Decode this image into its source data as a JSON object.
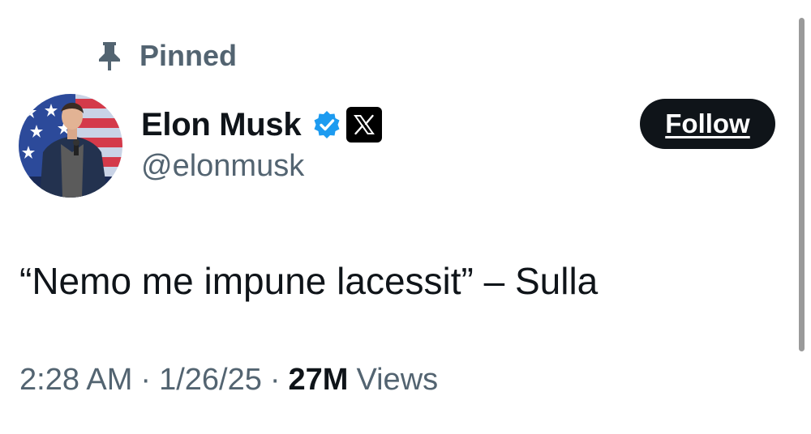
{
  "pinned": {
    "label": "Pinned",
    "icon": "pin-icon"
  },
  "author": {
    "display_name": "Elon Musk",
    "handle": "@elonmusk",
    "verified_icon": "verified-badge-icon",
    "affiliation_icon": "x-logo-icon"
  },
  "follow_button": {
    "label": "Follow"
  },
  "tweet": {
    "text": "“Nemo me impune lacessit” – Sulla"
  },
  "meta": {
    "time": "2:28 AM",
    "separator": "·",
    "date": "1/26/25",
    "views_count": "27M",
    "views_label": "Views"
  },
  "colors": {
    "text_primary": "#0f1419",
    "text_secondary": "#536471",
    "verified_blue": "#1d9bf0",
    "button_bg": "#0f1419"
  }
}
